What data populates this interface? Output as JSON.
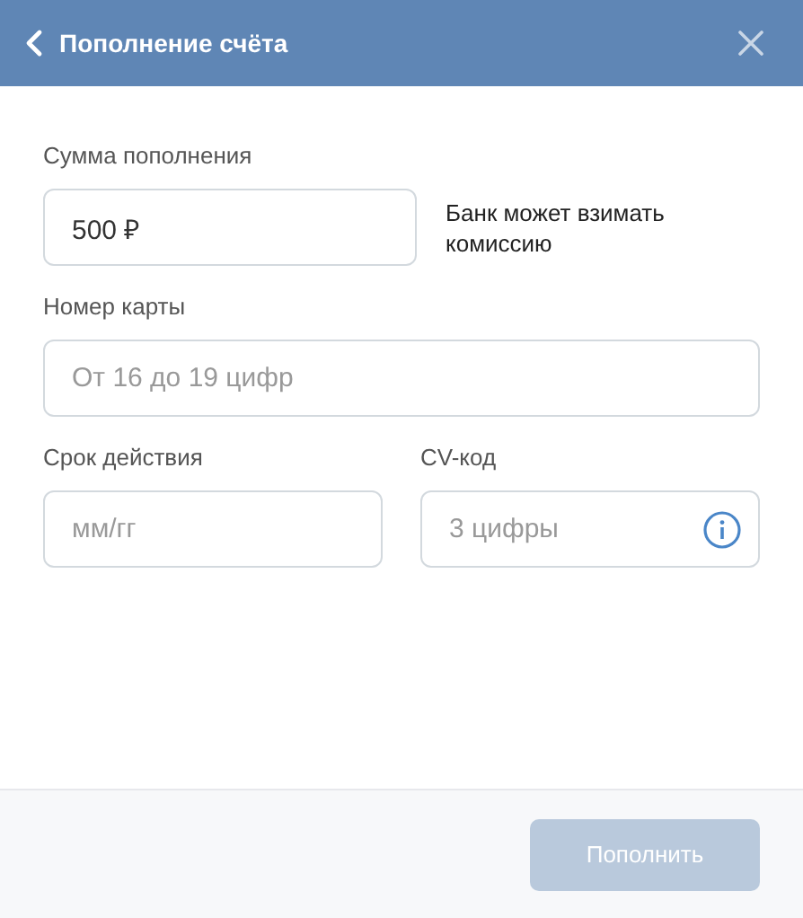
{
  "header": {
    "title": "Пополнение счёта"
  },
  "amount": {
    "label": "Сумма пополнения",
    "value": "500 ₽",
    "note": "Банк может взимать комиссию"
  },
  "card_number": {
    "label": "Номер карты",
    "placeholder": "От 16 до 19 цифр"
  },
  "expiry": {
    "label": "Срок действия",
    "placeholder": "мм/гг"
  },
  "cvc": {
    "label": "CV-код",
    "placeholder": "3 цифры"
  },
  "submit": {
    "label": "Пополнить",
    "disabled": true
  }
}
